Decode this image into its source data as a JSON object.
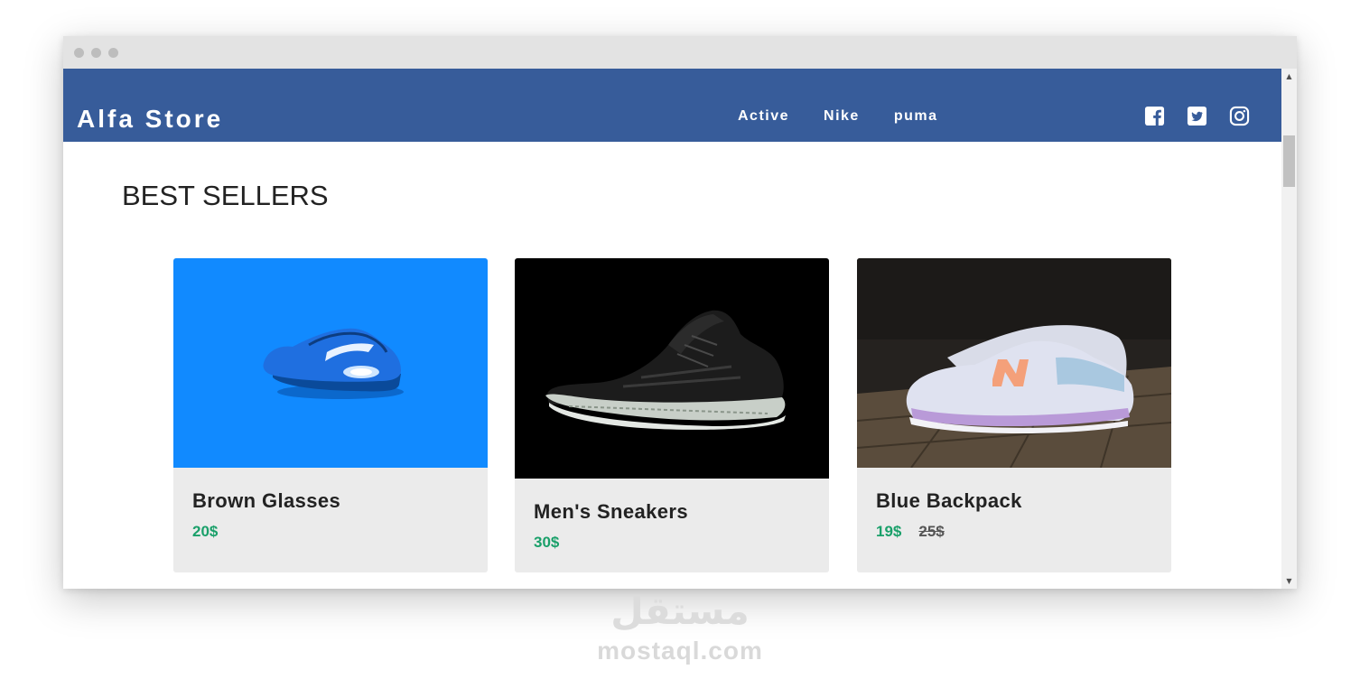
{
  "window": {
    "controls": [
      "close",
      "minimize",
      "maximize"
    ]
  },
  "navbar": {
    "brand": "Alfa Store",
    "links": [
      "Active",
      "Nike",
      "puma"
    ],
    "social_icons": [
      "facebook-icon",
      "twitter-icon",
      "instagram-icon"
    ],
    "background": "#375c9a"
  },
  "main": {
    "section_title": "BEST SELLERS",
    "products": [
      {
        "title": "Brown Glasses",
        "price": "20$",
        "old_price": "",
        "image": "blue-sneaker-image",
        "image_background": "#118aff"
      },
      {
        "title": "Men's Sneakers",
        "price": "30$",
        "old_price": "",
        "image": "black-sneaker-image",
        "image_background": "#000000"
      },
      {
        "title": "Blue Backpack",
        "price": "19$",
        "old_price": "25$",
        "image": "lavender-sneaker-image",
        "image_background": "#3a3530"
      }
    ]
  },
  "colors": {
    "price": "#1aa06a",
    "card_background": "#ebebeb"
  },
  "watermark": {
    "arabic": "مستقل",
    "latin": "mostaql.com"
  }
}
